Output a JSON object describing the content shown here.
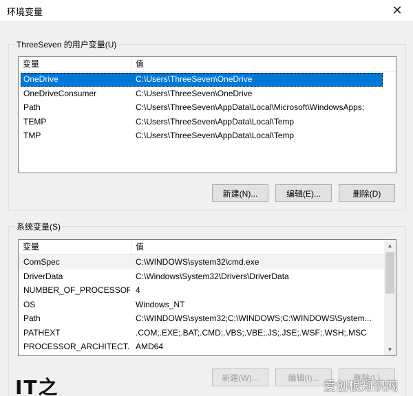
{
  "window": {
    "title": "环境变量",
    "close_glyph": "✕"
  },
  "user_vars": {
    "group_label": "ThreeSeven 的用户变量(U)",
    "columns": [
      "变量",
      "值"
    ],
    "rows": [
      {
        "name": "OneDrive",
        "value": "C:\\Users\\ThreeSeven\\OneDrive",
        "selected": true
      },
      {
        "name": "OneDriveConsumer",
        "value": "C:\\Users\\ThreeSeven\\OneDrive"
      },
      {
        "name": "Path",
        "value": "C:\\Users\\ThreeSeven\\AppData\\Local\\Microsoft\\WindowsApps;"
      },
      {
        "name": "TEMP",
        "value": "C:\\Users\\ThreeSeven\\AppData\\Local\\Temp"
      },
      {
        "name": "TMP",
        "value": "C:\\Users\\ThreeSeven\\AppData\\Local\\Temp"
      }
    ],
    "buttons": {
      "new": "新建(N)...",
      "edit": "编辑(E)...",
      "delete": "删除(D)"
    }
  },
  "system_vars": {
    "group_label": "系统变量(S)",
    "columns": [
      "变量",
      "值"
    ],
    "rows": [
      {
        "name": "ComSpec",
        "value": "C:\\WINDOWS\\system32\\cmd.exe"
      },
      {
        "name": "DriverData",
        "value": "C:\\Windows\\System32\\Drivers\\DriverData"
      },
      {
        "name": "NUMBER_OF_PROCESSORS",
        "value": "4"
      },
      {
        "name": "OS",
        "value": "Windows_NT"
      },
      {
        "name": "Path",
        "value": "C:\\WINDOWS\\system32;C:\\WINDOWS;C:\\WINDOWS\\System..."
      },
      {
        "name": "PATHEXT",
        "value": ".COM;.EXE;.BAT;.CMD;.VBS;.VBE;.JS;.JSE;.WSF;.WSH;.MSC"
      },
      {
        "name": "PROCESSOR_ARCHITECT...",
        "value": "AMD64"
      }
    ],
    "buttons": {
      "new": "新建(W)...",
      "edit": "编辑(I)...",
      "delete": "删除(L)"
    },
    "scroll_up_glyph": "▲",
    "scroll_down_glyph": "▼"
  },
  "watermarks": {
    "left": "IT之",
    "right": "爱创根知识网"
  },
  "colors": {
    "selection": "#0078d7",
    "dialog_bg": "#f0f0f0"
  }
}
